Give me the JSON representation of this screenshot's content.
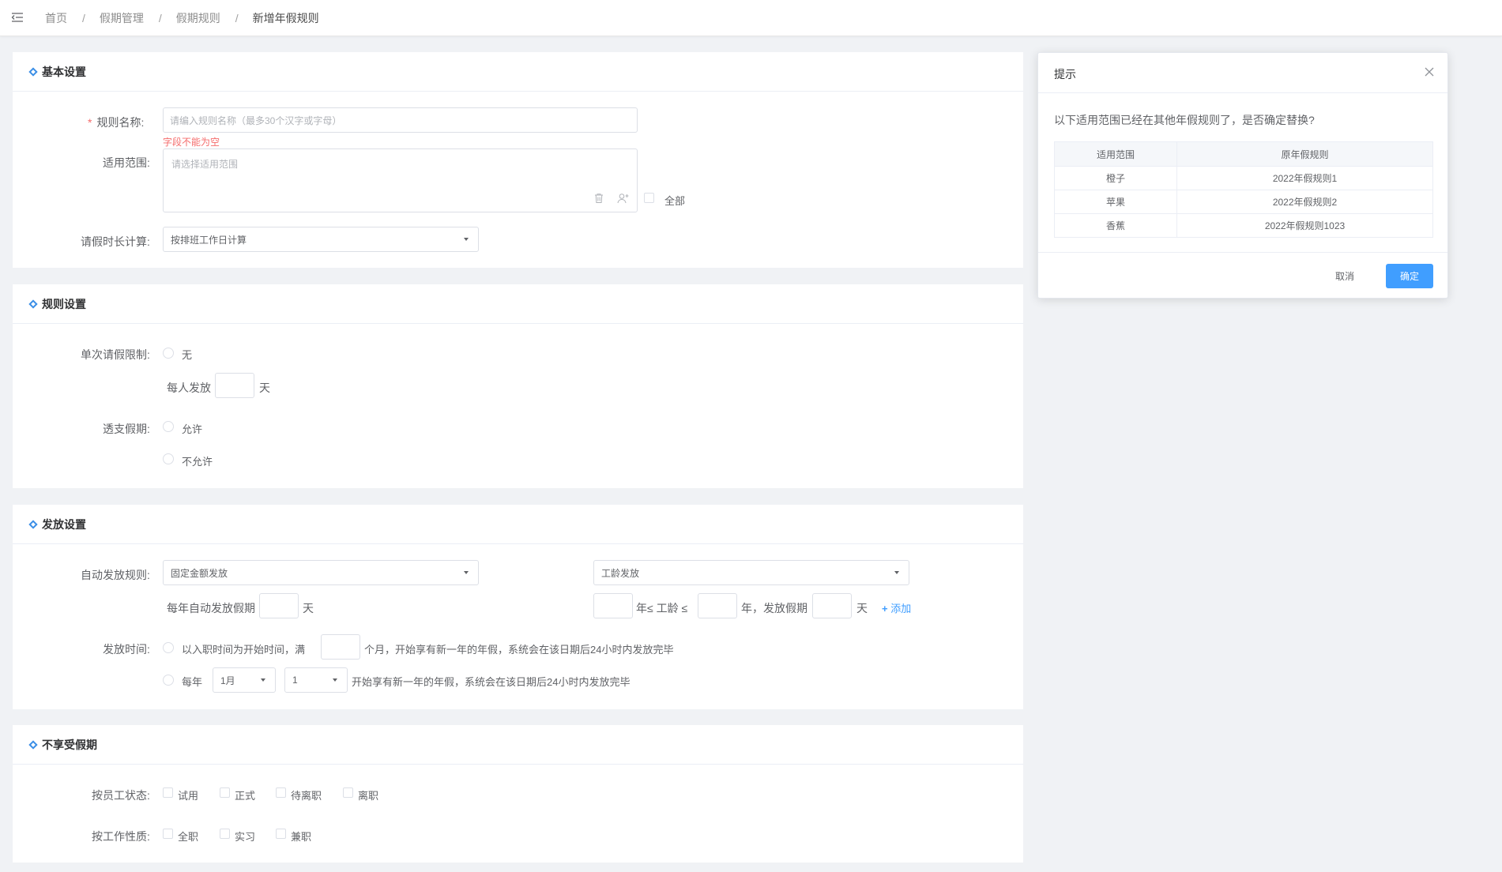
{
  "breadcrumb": [
    "首页",
    "假期管理",
    "假期规则",
    "新增年假规则"
  ],
  "basic": {
    "title": "基本设置",
    "rule_name_label": "规则名称:",
    "rule_name_placeholder": "请编入规则名称（最多30个汉字或字母）",
    "rule_name_error": "字段不能为空",
    "scope_label": "适用范围:",
    "scope_placeholder": "请选择适用范围",
    "all_label": "全部",
    "duration_label": "请假时长计算:",
    "duration_value": "按排班工作日计算"
  },
  "rules": {
    "title": "规则设置",
    "single_limit_label": "单次请假限制:",
    "none_label": "无",
    "per_person_label": "每人发放",
    "day_unit": "天",
    "overdraft_label": "透支假期:",
    "allow_label": "允许",
    "disallow_label": "不允许"
  },
  "grant": {
    "title": "发放设置",
    "auto_rule_label": "自动发放规则:",
    "auto_rule_value": "固定金额发放",
    "seniority_value": "工龄发放",
    "yearly_label": "每年自动发放假期",
    "day_unit": "天",
    "year_le_seniority": "年≤ 工龄 ≤",
    "year_grant_label": "年，发放假期",
    "add_label": "添加",
    "time_label": "发放时间:",
    "hire_prefix": "以入职时间为开始时间，满",
    "hire_suffix": "个月，开始享有新一年的年假，系统会在该日期后24小时内发放完毕",
    "yearly_prefix": "每年",
    "month_value": "1月",
    "day_value": "1",
    "yearly_suffix": "开始享有新一年的年假，系统会在该日期后24小时内发放完毕"
  },
  "exclude": {
    "title": "不享受假期",
    "status_label": "按员工状态:",
    "status_options": [
      "试用",
      "正式",
      "待离职",
      "离职"
    ],
    "nature_label": "按工作性质:",
    "nature_options": [
      "全职",
      "实习",
      "兼职"
    ]
  },
  "dialog": {
    "title": "提示",
    "message": "以下适用范围已经在其他年假规则了，是否确定替换?",
    "columns": [
      "适用范围",
      "原年假规则"
    ],
    "rows": [
      [
        "橙子",
        "2022年假规则1"
      ],
      [
        "苹果",
        "2022年假规则2"
      ],
      [
        "香蕉",
        "2022年假规则1023"
      ]
    ],
    "cancel_label": "取消",
    "ok_label": "确定"
  },
  "colors": {
    "accent": "#409eff",
    "error": "#f56c6c",
    "section_marker": "#3a8ee6"
  }
}
